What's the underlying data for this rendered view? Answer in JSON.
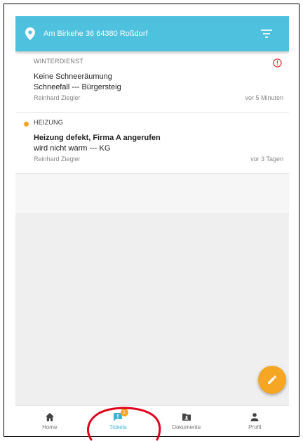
{
  "header": {
    "address": "Am Birkehe 36 64380 Roßdorf"
  },
  "tickets": [
    {
      "category": "WINTERDIENST",
      "title": "Keine Schneeräumung",
      "description": "Schneefall --- Bürgersteig",
      "author": "Reinhard Ziegler",
      "time": "vor 5 Minuten",
      "icon": "alert-circle-icon",
      "unread": false
    },
    {
      "category": "HEIZUNG",
      "title": "Heizung defekt, Firma A angerufen",
      "description": "wird nicht warm --- KG",
      "author": "Reinhard Ziegler",
      "time": "vor 3 Tagen",
      "unread": true
    }
  ],
  "nav": {
    "items": [
      {
        "label": "Home",
        "icon": "home-icon"
      },
      {
        "label": "Tickets",
        "icon": "ticket-icon",
        "badge": "1",
        "active": true
      },
      {
        "label": "Dokumente",
        "icon": "folder-icon"
      },
      {
        "label": "Profil",
        "icon": "person-icon"
      }
    ]
  },
  "colors": {
    "header": "#4ec1de",
    "accent": "#f5a623",
    "alert": "#e53935",
    "active_nav": "#3fb2d8",
    "annotation": "#e0001b"
  }
}
